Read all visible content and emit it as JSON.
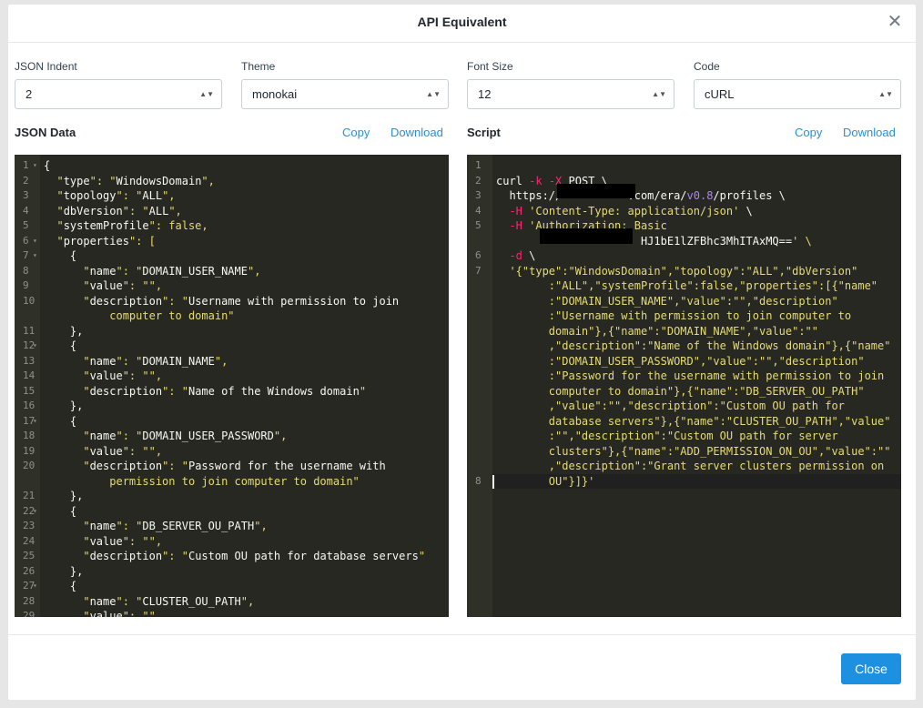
{
  "dialog": {
    "title": "API Equivalent",
    "close_label": "Close"
  },
  "icons": {
    "close": "close-icon",
    "select_arrows": "chevron-up-down-icon",
    "fold": "fold-arrow-icon"
  },
  "settings": {
    "json_indent": {
      "label": "JSON Indent",
      "value": "2"
    },
    "theme": {
      "label": "Theme",
      "value": "monokai"
    },
    "font_size": {
      "label": "Font Size",
      "value": "12"
    },
    "code": {
      "label": "Code",
      "value": "cURL"
    }
  },
  "json_panel": {
    "title": "JSON Data",
    "copy_label": "Copy",
    "download_label": "Download",
    "line_numbers": [
      "1",
      "2",
      "3",
      "4",
      "5",
      "6",
      "7",
      "8",
      "9",
      "10",
      "",
      "11",
      "12",
      "13",
      "14",
      "15",
      "16",
      "17",
      "18",
      "19",
      "20",
      "",
      "21",
      "22",
      "23",
      "24",
      "25",
      "26",
      "27",
      "28",
      "29"
    ],
    "lines": [
      "{",
      "  \"type\": \"WindowsDomain\",",
      "  \"topology\": \"ALL\",",
      "  \"dbVersion\": \"ALL\",",
      "  \"systemProfile\": false,",
      "  \"properties\": [",
      "    {",
      "      \"name\": \"DOMAIN_USER_NAME\",",
      "      \"value\": \"\",",
      "      \"description\": \"Username with permission to join",
      "          computer to domain\"",
      "    },",
      "    {",
      "      \"name\": \"DOMAIN_NAME\",",
      "      \"value\": \"\",",
      "      \"description\": \"Name of the Windows domain\"",
      "    },",
      "    {",
      "      \"name\": \"DOMAIN_USER_PASSWORD\",",
      "      \"value\": \"\",",
      "      \"description\": \"Password for the username with",
      "          permission to join computer to domain\"",
      "    },",
      "    {",
      "      \"name\": \"DB_SERVER_OU_PATH\",",
      "      \"value\": \"\",",
      "      \"description\": \"Custom OU path for database servers\"",
      "    },",
      "    {",
      "      \"name\": \"CLUSTER_OU_PATH\",",
      "      \"value\": \"\","
    ]
  },
  "script_panel": {
    "title": "Script",
    "copy_label": "Copy",
    "download_label": "Download",
    "line_numbers": [
      "1",
      "2",
      "3",
      "4",
      "5",
      "",
      "6",
      "7",
      "",
      "",
      "",
      "",
      "",
      "",
      "",
      "",
      "",
      "",
      "",
      "",
      "",
      "8"
    ],
    "lines": [
      "",
      "curl -k -X POST \\",
      "  https://          .com/era/v0.8/profiles \\",
      "  -H 'Content-Type: application/json' \\",
      "  -H 'Authorization: Basic",
      "                      HJ1bE1lZFBhc3MhITAxMQ==' \\",
      "  -d \\",
      "  '{\"type\":\"WindowsDomain\",\"topology\":\"ALL\",\"dbVersion\"",
      "        :\"ALL\",\"systemProfile\":false,\"properties\":[{\"name\"",
      "        :\"DOMAIN_USER_NAME\",\"value\":\"\",\"description\"",
      "        :\"Username with permission to join computer to",
      "        domain\"},{\"name\":\"DOMAIN_NAME\",\"value\":\"\"",
      "        ,\"description\":\"Name of the Windows domain\"},{\"name\"",
      "        :\"DOMAIN_USER_PASSWORD\",\"value\":\"\",\"description\"",
      "        :\"Password for the username with permission to join",
      "        computer to domain\"},{\"name\":\"DB_SERVER_OU_PATH\"",
      "        ,\"value\":\"\",\"description\":\"Custom OU path for",
      "        database servers\"},{\"name\":\"CLUSTER_OU_PATH\",\"value\"",
      "        :\"\",\"description\":\"Custom OU path for server",
      "        clusters\"},{\"name\":\"ADD_PERMISSION_ON_OU\",\"value\":\"\"",
      "        ,\"description\":\"Grant server clusters permission on",
      "        OU\"}]}'"
    ]
  }
}
